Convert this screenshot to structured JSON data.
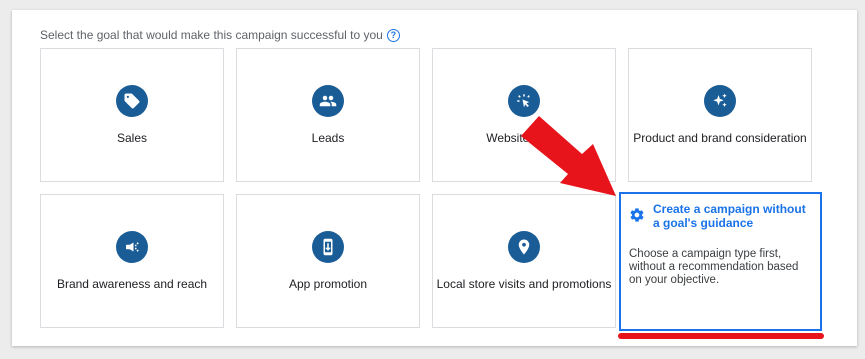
{
  "prompt": {
    "text": "Select the goal that would make this campaign successful to you",
    "help_icon": "question-circle-icon"
  },
  "goals": [
    {
      "label": "Sales",
      "icon": "tag-icon"
    },
    {
      "label": "Leads",
      "icon": "people-icon"
    },
    {
      "label": "Website traffic",
      "icon": "cursor-click-icon"
    },
    {
      "label": "Product and brand consideration",
      "icon": "sparkle-icon"
    },
    {
      "label": "Brand awareness and reach",
      "icon": "megaphone-icon"
    },
    {
      "label": "App promotion",
      "icon": "phone-download-icon"
    },
    {
      "label": "Local store visits and promotions",
      "icon": "map-pin-icon"
    }
  ],
  "no_goal": {
    "title": "Create a campaign without a goal's guidance",
    "description": "Choose a campaign type first, without a recommendation based on your objective.",
    "icon": "gear-icon"
  },
  "colors": {
    "accent": "#1a73e8",
    "icon_bg": "#1a5c96",
    "annotation": "#e8141c"
  }
}
